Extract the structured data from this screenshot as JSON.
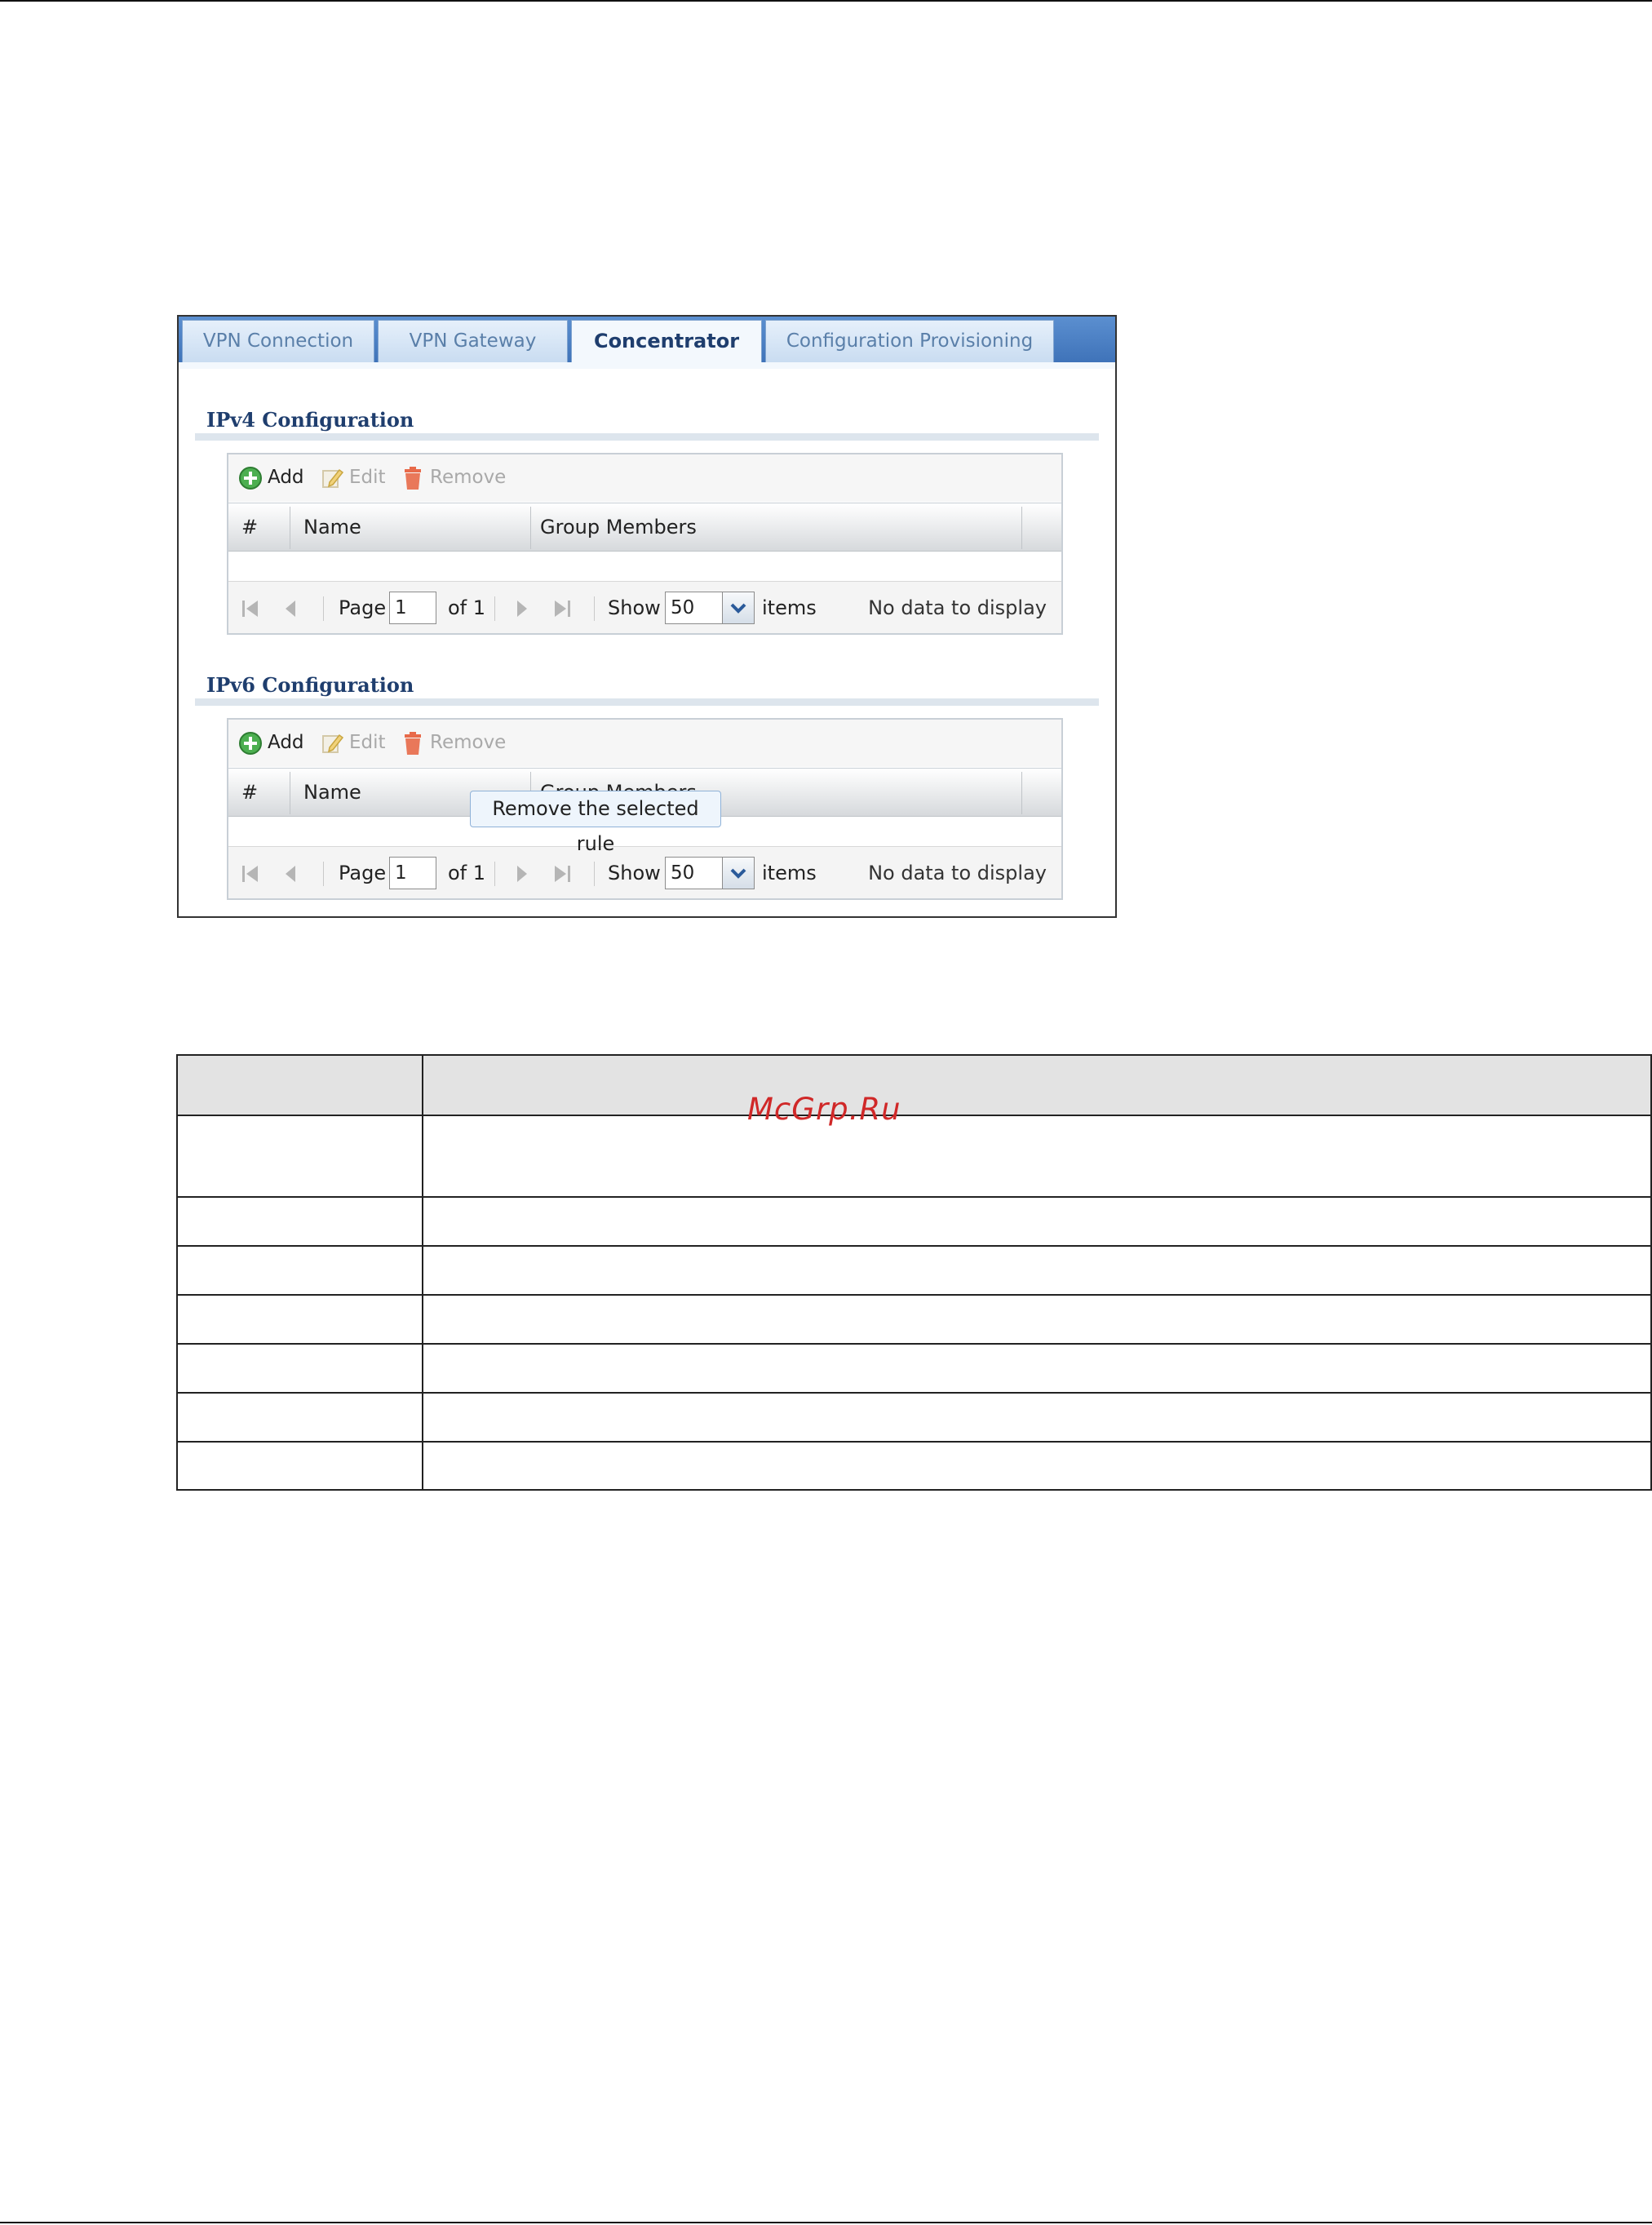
{
  "tabs": [
    {
      "label": "VPN Connection"
    },
    {
      "label": "VPN Gateway"
    },
    {
      "label": "Concentrator"
    },
    {
      "label": "Configuration Provisioning"
    }
  ],
  "active_tab": "Concentrator",
  "ipv4": {
    "title": "IPv4 Configuration",
    "toolbar": {
      "add": "Add",
      "edit": "Edit",
      "remove": "Remove"
    },
    "columns": [
      "#",
      "Name",
      "Group Members"
    ],
    "pager": {
      "page_label": "Page",
      "page_value": "1",
      "of_label": "of 1",
      "show_label": "Show",
      "show_value": "50",
      "items_label": "items",
      "status": "No data to display"
    }
  },
  "ipv6": {
    "title": "IPv6 Configuration",
    "toolbar": {
      "add": "Add",
      "edit": "Edit",
      "remove": "Remove"
    },
    "columns": [
      "#",
      "Name",
      "Group Members"
    ],
    "pager": {
      "page_label": "Page",
      "page_value": "1",
      "of_label": "of 1",
      "show_label": "Show",
      "show_value": "50",
      "items_label": "items",
      "status": "No data to display"
    }
  },
  "tooltip": "Remove the selected rule",
  "watermark": "McGrp.Ru",
  "colors": {
    "accent": "#3f73b9",
    "title": "#1f3e6e",
    "add_icon": "#4caf50",
    "remove_icon": "#e05a3a"
  }
}
